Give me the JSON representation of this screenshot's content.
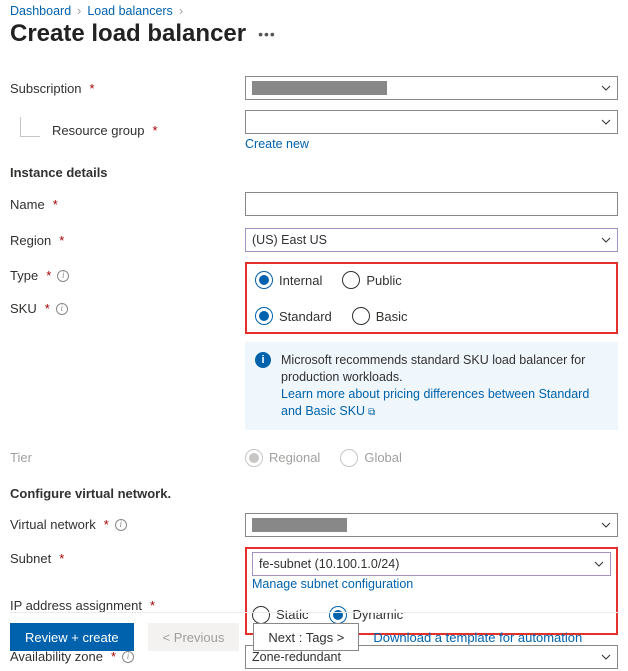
{
  "breadcrumbs": {
    "items": [
      "Dashboard",
      "Load balancers",
      ""
    ]
  },
  "header": {
    "title": "Create load balancer"
  },
  "subscription": {
    "label": "Subscription",
    "value": "████████████"
  },
  "resource_group": {
    "label": "Resource group",
    "value": "",
    "create_new": "Create new"
  },
  "instance_section": "Instance details",
  "name_field": {
    "label": "Name",
    "value": ""
  },
  "region_field": {
    "label": "Region",
    "value": "(US) East US"
  },
  "type_field": {
    "label": "Type",
    "options": {
      "internal": "Internal",
      "public": "Public"
    },
    "selected": "internal"
  },
  "sku_field": {
    "label": "SKU",
    "options": {
      "standard": "Standard",
      "basic": "Basic"
    },
    "selected": "standard"
  },
  "sku_info": {
    "text": "Microsoft recommends standard SKU load balancer for production workloads.",
    "link": "Learn more about pricing differences between Standard and Basic SKU"
  },
  "tier_field": {
    "label": "Tier",
    "options": {
      "regional": "Regional",
      "global": "Global"
    },
    "selected": "regional",
    "disabled": true
  },
  "vnet_section": "Configure virtual network.",
  "vnet_field": {
    "label": "Virtual network",
    "value": "████████"
  },
  "subnet_field": {
    "label": "Subnet",
    "value": "fe-subnet (10.100.1.0/24)",
    "manage_link": "Manage subnet configuration"
  },
  "ip_assign": {
    "label": "IP address assignment",
    "options": {
      "static": "Static",
      "dynamic": "Dynamic"
    },
    "selected": "dynamic"
  },
  "az_field": {
    "label": "Availability zone",
    "value": "Zone-redundant"
  },
  "footer": {
    "review": "Review + create",
    "previous": "< Previous",
    "next": "Next : Tags >",
    "download_link": "Download a template for automation"
  }
}
